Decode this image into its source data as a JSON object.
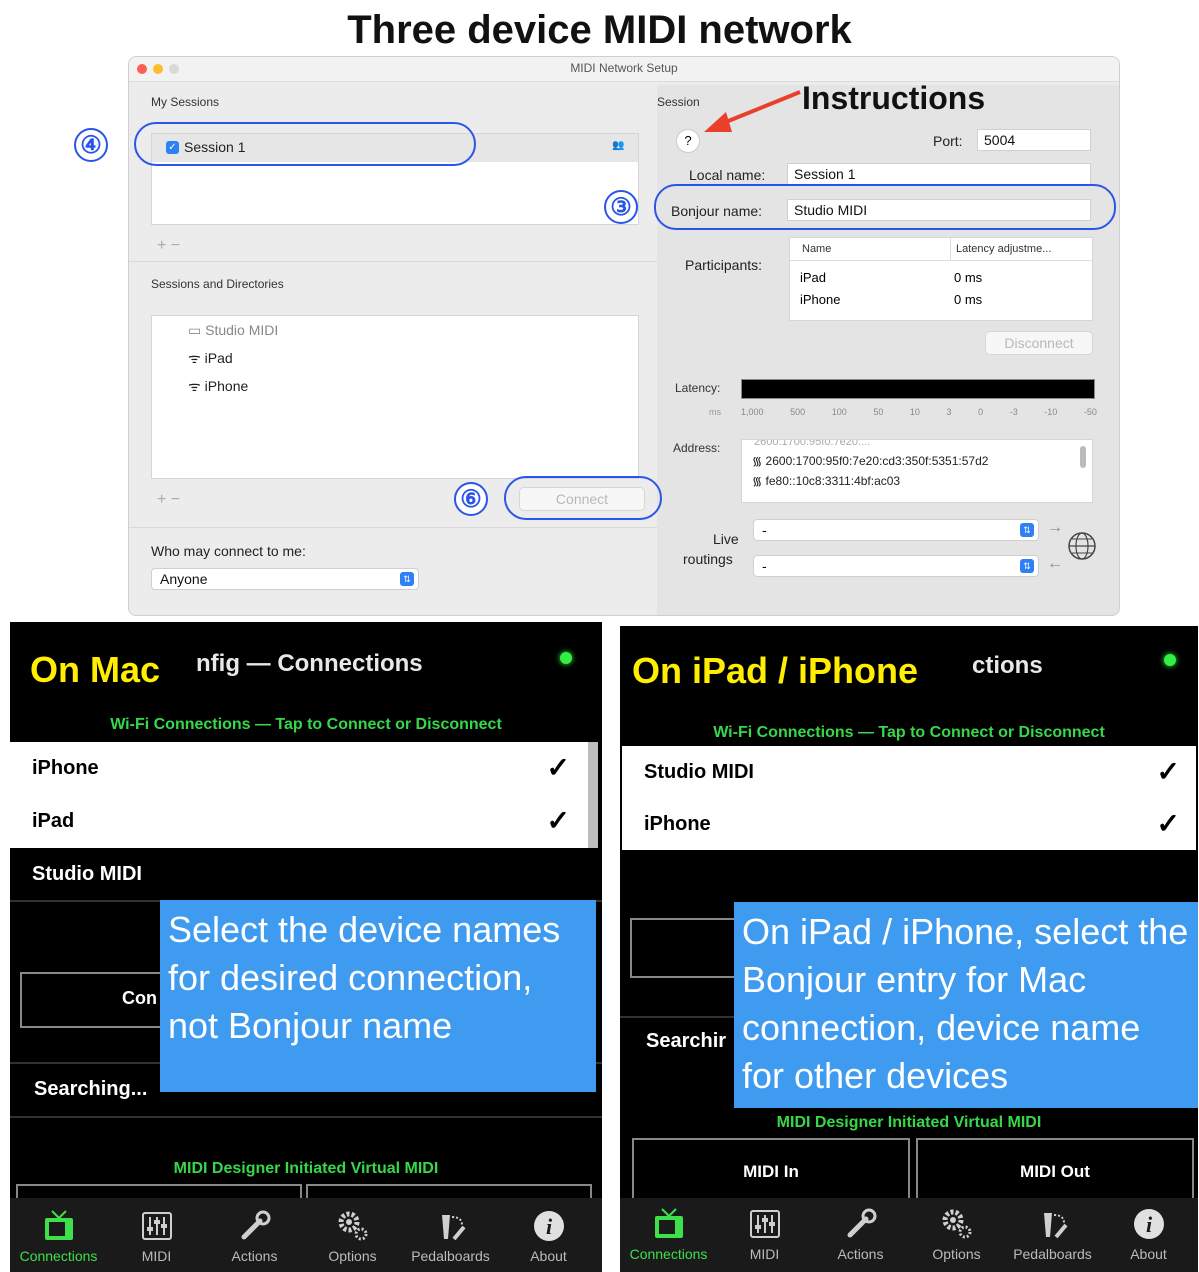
{
  "title": "Three device MIDI network",
  "window": {
    "title": "MIDI Network Setup",
    "my_sessions_label": "My Sessions",
    "session_item": "Session 1",
    "sessions_dirs_label": "Sessions and Directories",
    "directory_items": [
      "Studio MIDI",
      "iPad",
      "iPhone"
    ],
    "connect_label": "Connect",
    "who_label": "Who may connect to me:",
    "who_value": "Anyone",
    "plus_minus": "+  −",
    "session_label": "Session",
    "help": "?",
    "port_label": "Port:",
    "port_value": "5004",
    "local_name_label": "Local name:",
    "local_name_value": "Session 1",
    "bonjour_label": "Bonjour name:",
    "bonjour_value": "Studio MIDI",
    "participants_label": "Participants:",
    "participants_headers": [
      "Name",
      "Latency adjustme..."
    ],
    "participants": [
      {
        "name": "iPad",
        "latency": "0 ms"
      },
      {
        "name": "iPhone",
        "latency": "0 ms"
      }
    ],
    "disconnect_label": "Disconnect",
    "latency_label": "Latency:",
    "latency_unit": "ms",
    "latency_ticks": [
      "1,000",
      "500",
      "100",
      "50",
      "10",
      "3",
      "0",
      "-3",
      "-10",
      "-50"
    ],
    "address_label": "Address:",
    "addresses": [
      "2600:1700:95f0:7e20:cd3:350f:5351:57d2",
      "fe80::10c8:3311:4bf:ac03"
    ],
    "address_partial": "2600:1700:95f0:7e20:...",
    "live_label": "Live",
    "routings_label": "routings",
    "routing_in": "-",
    "routing_out": "-"
  },
  "annotations": {
    "instructions": "Instructions",
    "num_3": "③",
    "num_4": "④",
    "num_6": "⑥"
  },
  "mac_panel": {
    "label": "On Mac",
    "title_visible": "nfig — Connections",
    "section": "Wi-Fi Connections — Tap to Connect or Disconnect",
    "rows": [
      {
        "name": "iPhone",
        "check": "✓"
      },
      {
        "name": "iPad",
        "check": "✓"
      }
    ],
    "bonjour_row": "Studio MIDI",
    "partial_button": "Con",
    "searching": "Searching...",
    "virtual_section": "MIDI Designer Initiated Virtual MIDI",
    "callout": "Select the device names for desired connection, not Bonjour name"
  },
  "ios_panel": {
    "label": "On iPad / iPhone",
    "title_visible": "ctions",
    "section": "Wi-Fi Connections — Tap to Connect or Disconnect",
    "rows": [
      {
        "name": "Studio MIDI",
        "check": "✓"
      },
      {
        "name": "iPhone",
        "check": "✓"
      }
    ],
    "searching": "Searchir",
    "virtual_section": "MIDI Designer Initiated Virtual MIDI",
    "midi_in": "MIDI In",
    "midi_out": "MIDI Out",
    "callout": "On iPad / iPhone, select the Bonjour entry for Mac connection, device name for other devices"
  },
  "tabs": [
    "Connections",
    "MIDI",
    "Actions",
    "Options",
    "Pedalboards",
    "About"
  ],
  "colors": {
    "accent_green": "#36d84a",
    "callout_blue": "#3f9bf0",
    "annotation_blue": "#2a56e8",
    "label_yellow": "#ffee00",
    "arrow_red": "#e8402a"
  }
}
